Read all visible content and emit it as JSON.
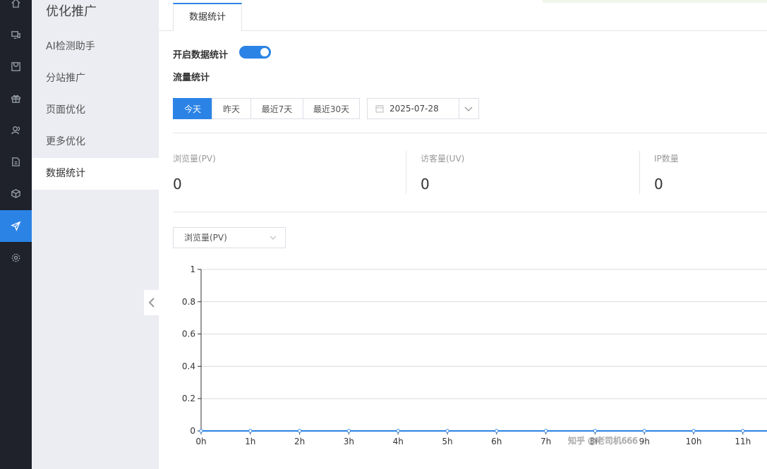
{
  "rail": {
    "icons": [
      "home-icon",
      "monitor-icon",
      "inbox-icon",
      "gift-icon",
      "users-icon",
      "document-icon",
      "cube-icon",
      "send-icon",
      "settings-icon"
    ],
    "active_index": 7,
    "accent": "#2b83e6"
  },
  "sidebar": {
    "title": "优化推广",
    "items": [
      {
        "label": "AI检测助手"
      },
      {
        "label": "分站推广"
      },
      {
        "label": "页面优化"
      },
      {
        "label": "更多优化"
      },
      {
        "label": "数据统计"
      }
    ],
    "active_index": 4
  },
  "tabs": [
    {
      "label": "数据统计"
    }
  ],
  "settings": {
    "enable_label": "开启数据统计",
    "enabled": true,
    "section_title": "流量统计"
  },
  "range_buttons": [
    {
      "label": "今天",
      "active": true
    },
    {
      "label": "昨天"
    },
    {
      "label": "最近7天"
    },
    {
      "label": "最近30天"
    }
  ],
  "date_picker": {
    "value": "2025-07-28"
  },
  "stats": [
    {
      "label": "浏览量(PV)",
      "value": "0"
    },
    {
      "label": "访客量(UV)",
      "value": "0"
    },
    {
      "label": "IP数量",
      "value": "0"
    }
  ],
  "metric_select": {
    "value": "浏览量(PV)"
  },
  "chart_data": {
    "type": "line",
    "categories": [
      "0h",
      "1h",
      "2h",
      "3h",
      "4h",
      "5h",
      "6h",
      "7h",
      "8h",
      "9h",
      "10h",
      "11h"
    ],
    "series": [
      {
        "values": [
          0,
          0,
          0,
          0,
          0,
          0,
          0,
          0,
          0,
          0,
          0,
          0
        ],
        "color": "#2b83e6"
      }
    ],
    "yticks": [
      "0",
      "0.2",
      "0.4",
      "0.6",
      "0.8",
      "1"
    ],
    "ylim": [
      0,
      1
    ],
    "grid": true
  },
  "watermark": "知乎 @老司机666"
}
